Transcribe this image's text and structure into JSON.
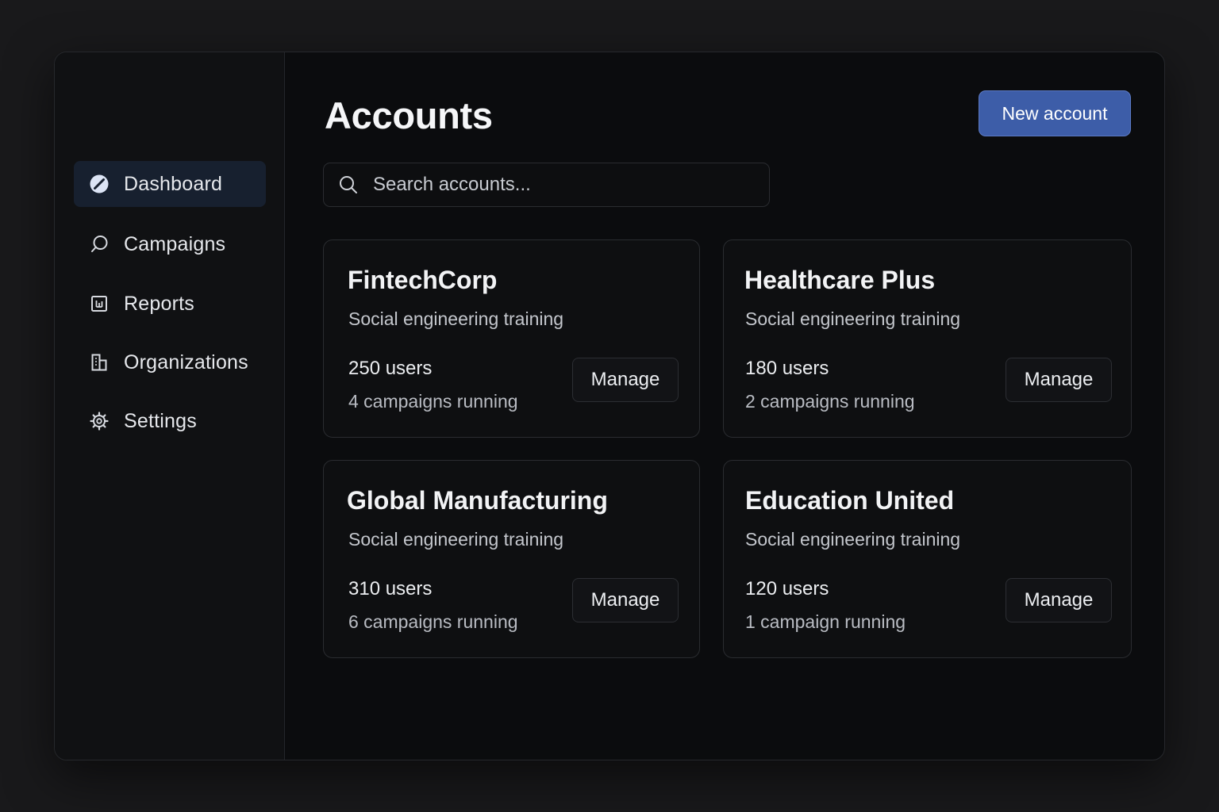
{
  "sidebar": {
    "items": [
      {
        "label": "Dashboard",
        "icon": "compass-icon",
        "active": true
      },
      {
        "label": "Campaigns",
        "icon": "chat-bubble-icon",
        "active": false
      },
      {
        "label": "Reports",
        "icon": "report-icon",
        "active": false
      },
      {
        "label": "Organizations",
        "icon": "building-icon",
        "active": false
      },
      {
        "label": "Settings",
        "icon": "gear-icon",
        "active": false
      }
    ]
  },
  "header": {
    "title": "Accounts",
    "new_button_label": "New account"
  },
  "search": {
    "placeholder": "Search accounts...",
    "value": ""
  },
  "accounts": [
    {
      "name": "FintechCorp",
      "subtitle": "Social engineering training",
      "users": "250 users",
      "campaigns": "4 campaigns running",
      "action": "Manage"
    },
    {
      "name": "Healthcare Plus",
      "subtitle": "Social engineering training",
      "users": "180 users",
      "campaigns": "2 campaigns running",
      "action": "Manage"
    },
    {
      "name": "Global Manufacturing",
      "subtitle": "Social engineering training",
      "users": "310 users",
      "campaigns": "6 campaigns running",
      "action": "Manage"
    },
    {
      "name": "Education United",
      "subtitle": "Social engineering training",
      "users": "120 users",
      "campaigns": "1 campaign running",
      "action": "Manage"
    }
  ],
  "colors": {
    "background": "#19191b",
    "window": "#0b0c0e",
    "sidebar": "#101113",
    "active_item": "#17202f",
    "accent": "#3d5da8",
    "border": "#2a2c30"
  }
}
